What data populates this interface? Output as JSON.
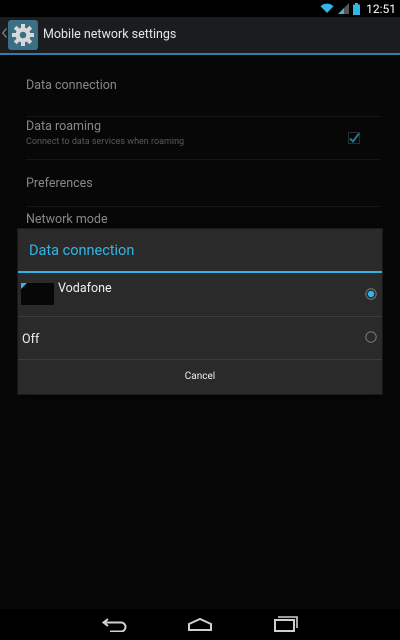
{
  "status_bar": {
    "time": "12:51",
    "icons": [
      "wifi-icon",
      "signal-icon",
      "battery-icon"
    ]
  },
  "action_bar": {
    "title": "Mobile network settings",
    "icon": "settings-gear-icon"
  },
  "settings": {
    "data_connection": "Data connection",
    "data_roaming": {
      "label": "Data roaming",
      "summary": "Connect to data services when roaming",
      "checked": true
    },
    "preferences": "Preferences",
    "network_mode": "Network mode"
  },
  "dialog": {
    "title": "Data connection",
    "options": [
      {
        "label": "Vodafone",
        "selected": true
      },
      {
        "label": "Off",
        "selected": false
      }
    ],
    "cancel": "Cancel"
  },
  "nav_bar": {
    "buttons": [
      "back-icon",
      "home-icon",
      "recents-icon"
    ]
  },
  "colors": {
    "accent": "#33b5e5",
    "action_bar_line": "#2f7ea6",
    "background": "#0b0b0b",
    "dialog": "#2a2a2a"
  }
}
